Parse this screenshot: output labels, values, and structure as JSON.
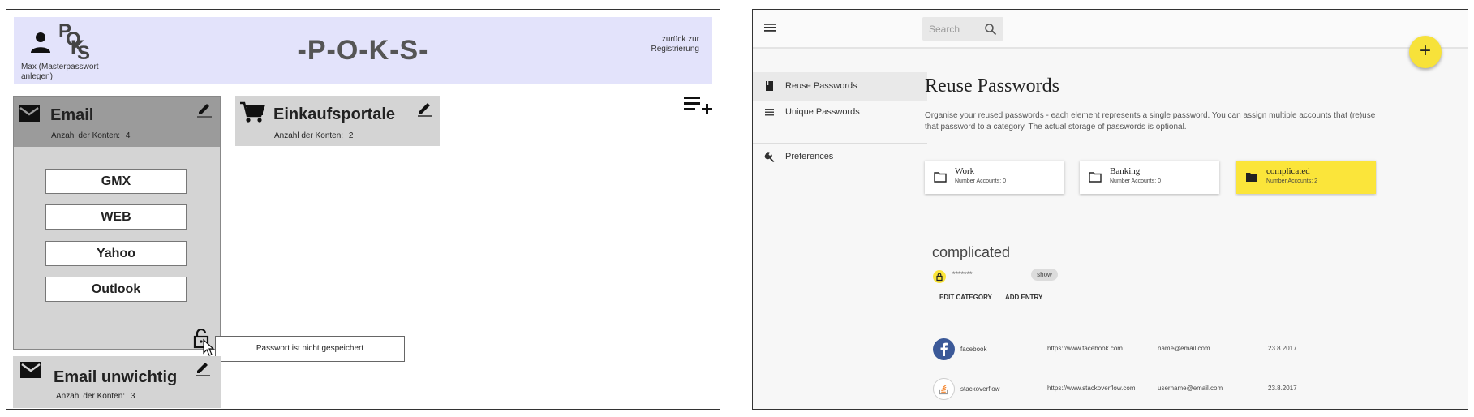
{
  "left_app": {
    "logo_letters": [
      "P",
      "O",
      "K",
      "S"
    ],
    "user_name": "Max (Masterpasswort anlegen)",
    "title": "-P-O-K-S-",
    "back_link": "zurück zur Registrierung",
    "categories": [
      {
        "title": "Email",
        "count_label": "Anzahl der Konten:",
        "count": "4",
        "icon": "envelope-icon",
        "accounts": [
          "GMX",
          "WEB",
          "Yahoo",
          "Outlook"
        ]
      },
      {
        "title": "Einkaufsportale",
        "count_label": "Anzahl der Konten:",
        "count": "2",
        "icon": "shopping-cart-icon"
      },
      {
        "title": "Email unwichtig",
        "count_label": "Anzahl der Konten:",
        "count": "3",
        "icon": "envelope-icon"
      }
    ],
    "tooltip": "Passwort ist nicht gespeichert"
  },
  "right_app": {
    "search_placeholder": "Search",
    "fab_label": "+",
    "nav": [
      {
        "label": "Reuse Passwords",
        "icon": "book-icon",
        "active": true
      },
      {
        "label": "Unique Passwords",
        "icon": "list-icon",
        "active": false
      },
      {
        "label": "Preferences",
        "icon": "wrench-icon",
        "active": false
      }
    ],
    "heading": "Reuse Passwords",
    "description": "Organise your reused passwords - each element represents a single password. You can assign multiple accounts that (re)use that password to a category. The actual storage of passwords is optional.",
    "categories": [
      {
        "name": "Work",
        "count": "Number Accounts: 0",
        "active": false
      },
      {
        "name": "Banking",
        "count": "Number Accounts: 0",
        "active": false
      },
      {
        "name": "complicated",
        "count": "Number Accounts: 2",
        "active": true
      }
    ],
    "selected": {
      "title": "complicated",
      "password_mask": "*******",
      "show_label": "show",
      "actions": [
        "EDIT CATEGORY",
        "ADD ENTRY"
      ]
    },
    "entries": [
      {
        "name": "facebook",
        "url": "https://www.facebook.com",
        "user": "name@email.com",
        "date": "23.8.2017"
      },
      {
        "name": "stackoverflow",
        "url": "https://www.stackoverflow.com",
        "user": "username@email.com",
        "date": "23.8.2017"
      }
    ],
    "colors": {
      "accent": "#fbe53a",
      "facebook": "#3b5998",
      "stackoverflow": "#f48024"
    }
  }
}
